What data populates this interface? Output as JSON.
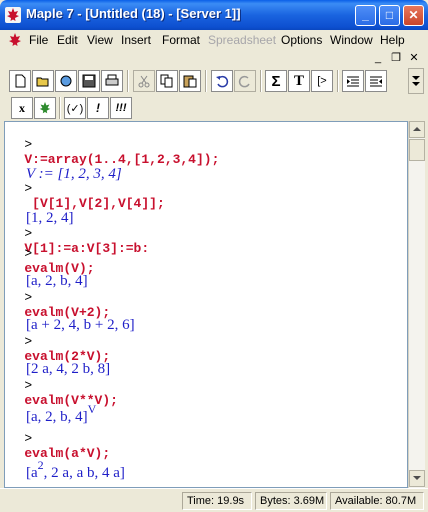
{
  "window": {
    "title": "Maple 7  - [Untitled (18) - [Server 1]]",
    "minimize_label": "_",
    "maximize_label": "□",
    "close_label": "✕"
  },
  "menu": {
    "items": [
      "File",
      "Edit",
      "View",
      "Insert",
      "Format",
      "Spreadsheet",
      "Options",
      "Window",
      "Help"
    ],
    "disabled": [
      "Spreadsheet"
    ],
    "mdi_minimize": "_",
    "mdi_restore": "❐",
    "mdi_close": "✕"
  },
  "toolbar": {
    "sum_label": "Σ",
    "text_label": "T",
    "prompt_label": "[>",
    "exec_selection": "(✓)",
    "exec_single": "!",
    "exec_all": "!!!",
    "x_label": "x"
  },
  "worksheet": {
    "prompt_symbol": ">",
    "lines": [
      {
        "kind": "input",
        "text": "V:=array(1..4,[1,2,3,4]);"
      },
      {
        "kind": "output",
        "text": "V := [1, 2, 3, 4]"
      },
      {
        "kind": "input",
        "text": " [V[1],V[2],V[4]];"
      },
      {
        "kind": "output",
        "text": "[1, 2, 4]"
      },
      {
        "kind": "input",
        "text": "V[1]:=a:V[3]:=b:"
      },
      {
        "kind": "input",
        "text": "evalm(V);"
      },
      {
        "kind": "output",
        "text": "[a, 2, b, 4]"
      },
      {
        "kind": "input",
        "text": "evalm(V+2);"
      },
      {
        "kind": "output",
        "text": "[a + 2, 4, b + 2, 6]"
      },
      {
        "kind": "input",
        "text": "evalm(2*V);"
      },
      {
        "kind": "output",
        "text": "[2 a, 4, 2 b, 8]"
      },
      {
        "kind": "input",
        "text": "evalm(V**V);"
      },
      {
        "kind": "output",
        "text": "[a, 2, b, 4]",
        "superscript": "V"
      },
      {
        "kind": "input",
        "text": "evalm(a*V);"
      },
      {
        "kind": "output",
        "text": "[a",
        "superscript": "2",
        "tail": ", 2 a, a b, 4 a]"
      }
    ]
  },
  "status": {
    "time": "Time: 19.9s",
    "bytes": "Bytes: 3.69M",
    "available": "Available: 80.7M"
  }
}
